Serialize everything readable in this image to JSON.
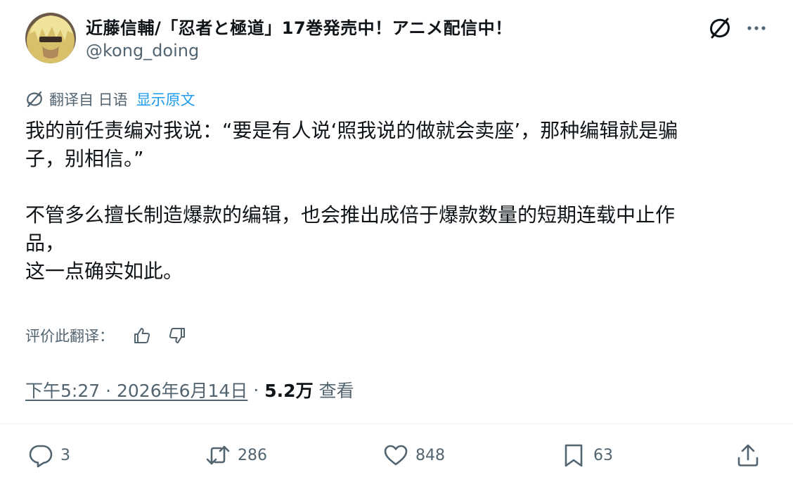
{
  "author": {
    "display_name": "近藤信輔/「忍者と極道」17巻発売中！アニメ配信中！",
    "handle": "@kong_doing"
  },
  "translation": {
    "label": "翻译自 日语",
    "show_original": "显示原文"
  },
  "tweet": {
    "paragraph1": "我的前任责编对我说：“要是有人说‘照我说的做就会卖座’，那种编辑就是骗\n子，别相信。”",
    "paragraph2": "不管多么擅长制造爆款的编辑，也会推出成倍于爆款数量的短期连载中止作\n品，\n这一点确实如此。"
  },
  "rate": {
    "label": "评价此翻译："
  },
  "meta": {
    "time": "下午5:27 · 2026年6月14日",
    "separator": "·",
    "views": "5.2万",
    "views_label": "查看"
  },
  "actions": {
    "replies": "3",
    "retweets": "286",
    "likes": "848",
    "bookmarks": "63"
  },
  "colors": {
    "text": "#0f1419",
    "secondary": "#536471",
    "link": "#1d9bf0",
    "divider": "#eff3f4"
  },
  "icons": [
    "grok-icon",
    "more-icon",
    "translate-icon",
    "thumbs-up-icon",
    "thumbs-down-icon",
    "reply-icon",
    "retweet-icon",
    "like-icon",
    "bookmark-icon",
    "share-icon"
  ]
}
